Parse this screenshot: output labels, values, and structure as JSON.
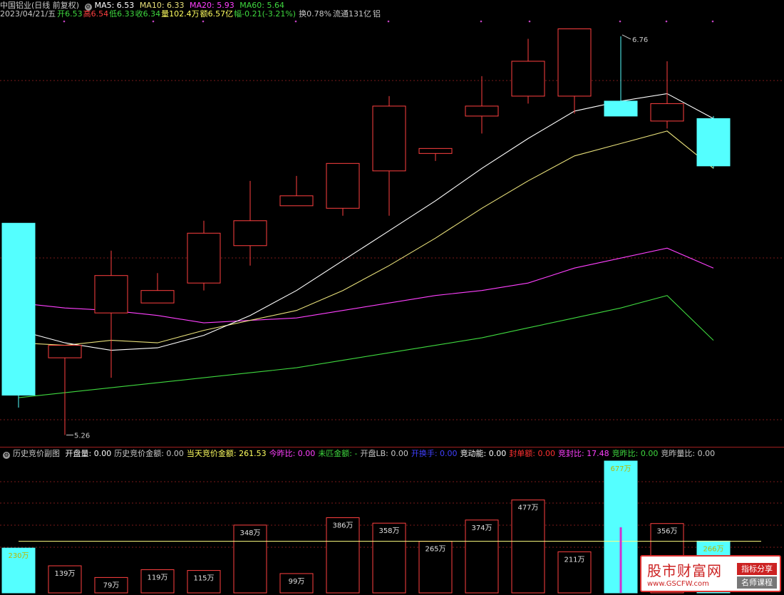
{
  "header": {
    "stock_name": "中国铝业",
    "period": "(日线 前复权)",
    "ma5": "MA5: 6.53",
    "ma10": "MA10: 6.33",
    "ma20": "MA20: 5.93",
    "ma60": "MA60: 5.64",
    "date": "2023/04/21/五",
    "open": "开6.53",
    "high": "高6.54",
    "low": "低6.33",
    "close": "收6.34",
    "volume": "量102.4万",
    "amount": "额6.57亿",
    "change": "幅-0.21(-3.21%)",
    "turnover": "换0.78%",
    "float": "流通131亿",
    "sector": "铝"
  },
  "colors": {
    "up": "#ff4040",
    "down": "#54ffff",
    "ma5": "#ffffff",
    "ma10": "#e8e07a",
    "ma20": "#ff40ff",
    "ma60": "#3fd93f",
    "grid": "#7a1a1a"
  },
  "chart_data": [
    {
      "type": "candlestick",
      "title": "中国铝业 (日线 前复权)",
      "candles": [
        {
          "o": 6.11,
          "h": 6.11,
          "l": 5.37,
          "c": 5.42
        },
        {
          "o": 5.57,
          "h": 5.6,
          "l": 5.26,
          "c": 5.62
        },
        {
          "o": 5.75,
          "h": 6.0,
          "l": 5.49,
          "c": 5.9
        },
        {
          "o": 5.79,
          "h": 5.91,
          "l": 5.79,
          "c": 5.84
        },
        {
          "o": 5.87,
          "h": 6.12,
          "l": 5.84,
          "c": 6.07
        },
        {
          "o": 6.02,
          "h": 6.28,
          "l": 5.94,
          "c": 6.12
        },
        {
          "o": 6.18,
          "h": 6.3,
          "l": 6.18,
          "c": 6.22
        },
        {
          "o": 6.17,
          "h": 6.35,
          "l": 6.14,
          "c": 6.35
        },
        {
          "o": 6.32,
          "h": 6.62,
          "l": 6.14,
          "c": 6.58
        },
        {
          "o": 6.39,
          "h": 6.4,
          "l": 6.36,
          "c": 6.41
        },
        {
          "o": 6.54,
          "h": 6.7,
          "l": 6.47,
          "c": 6.58
        },
        {
          "o": 6.62,
          "h": 6.85,
          "l": 6.59,
          "c": 6.76
        },
        {
          "o": 6.62,
          "h": 6.88,
          "l": 6.55,
          "c": 6.89
        },
        {
          "o": 6.6,
          "h": 6.86,
          "l": 6.56,
          "c": 6.54
        },
        {
          "o": 6.52,
          "h": 6.76,
          "l": 6.49,
          "c": 6.59
        },
        {
          "o": 6.53,
          "h": 6.54,
          "l": 6.33,
          "c": 6.34
        }
      ],
      "high_label": "6.76",
      "low_label": "5.26",
      "ma5": [
        5.68,
        5.63,
        5.6,
        5.61,
        5.66,
        5.74,
        5.84,
        5.96,
        6.08,
        6.2,
        6.33,
        6.45,
        6.56,
        6.6,
        6.63,
        6.53
      ],
      "ma10": [
        5.63,
        5.62,
        5.64,
        5.63,
        5.68,
        5.72,
        5.76,
        5.84,
        5.94,
        6.05,
        6.17,
        6.28,
        6.38,
        6.43,
        6.48,
        6.33
      ],
      "ma20": [
        5.79,
        5.77,
        5.76,
        5.74,
        5.71,
        5.72,
        5.73,
        5.76,
        5.79,
        5.82,
        5.84,
        5.87,
        5.93,
        5.97,
        6.01,
        5.93
      ],
      "ma60": [
        5.41,
        5.43,
        5.45,
        5.47,
        5.49,
        5.51,
        5.53,
        5.56,
        5.59,
        5.62,
        5.65,
        5.69,
        5.73,
        5.77,
        5.82,
        5.64
      ]
    },
    {
      "type": "bar",
      "title": "历史竞价副图",
      "values": [
        230,
        139,
        79,
        119,
        115,
        348,
        99,
        386,
        358,
        265,
        374,
        477,
        211,
        677,
        356,
        266
      ],
      "labels": [
        "230万",
        "139万",
        "79万",
        "119万",
        "115万",
        "348万",
        "99万",
        "386万",
        "358万",
        "265万",
        "374万",
        "477万",
        "211万",
        "677万",
        "356万",
        "266万"
      ],
      "colors": [
        "down",
        "up",
        "up",
        "up",
        "up",
        "up",
        "up",
        "up",
        "up",
        "up",
        "up",
        "up",
        "up",
        "down",
        "up",
        "down"
      ],
      "reference_line": 265
    }
  ],
  "sub_header": {
    "title": "历史竞价副图",
    "items": [
      {
        "label": "开盘量: 0.00",
        "color": "#ffffff"
      },
      {
        "label": "历史竞价金额: 0.00",
        "color": "#c8c8c8"
      },
      {
        "label": "当天竞价金额: 261.53",
        "color": "#ffff60"
      },
      {
        "label": "今昨比: 0.00",
        "color": "#ff40ff"
      },
      {
        "label": "未匹金额: -",
        "color": "#3fd93f"
      },
      {
        "label": "开盘LB: 0.00",
        "color": "#c8c8c8"
      },
      {
        "label": "开换手: 0.00",
        "color": "#4040ff"
      },
      {
        "label": "竞动能: 0.00",
        "color": "#ffffff"
      },
      {
        "label": "封单额: 0.00",
        "color": "#ff3030"
      },
      {
        "label": "竞封比: 17.48",
        "color": "#ff40ff"
      },
      {
        "label": "竞昨比: 0.00",
        "color": "#3fd93f"
      },
      {
        "label": "竞昨量比: 0.00",
        "color": "#c8c8c8"
      }
    ]
  },
  "watermark": {
    "title": "股市财富网",
    "url": "www.GSCFW.com",
    "tag1": "指标分享",
    "tag2": "名师课程"
  }
}
